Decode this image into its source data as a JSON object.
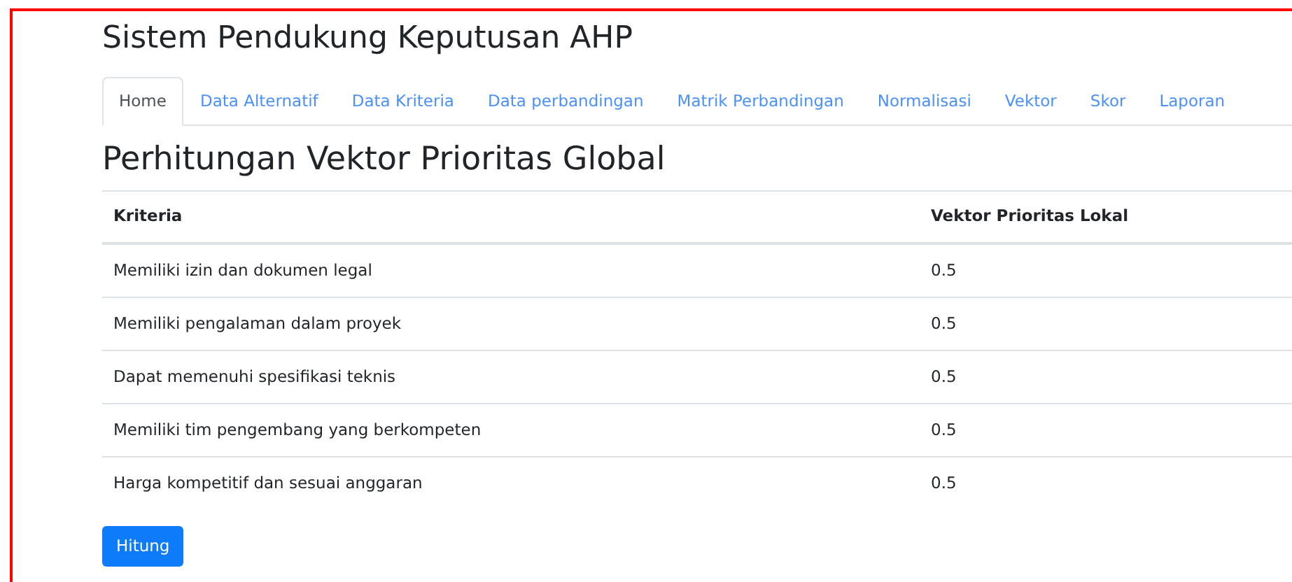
{
  "title": "Sistem Pendukung Keputusan AHP",
  "tabs": [
    {
      "label": "Home",
      "selected": true
    },
    {
      "label": "Data Alternatif",
      "selected": false
    },
    {
      "label": "Data Kriteria",
      "selected": false
    },
    {
      "label": "Data perbandingan",
      "selected": false
    },
    {
      "label": "Matrik Perbandingan",
      "selected": false
    },
    {
      "label": "Normalisasi",
      "selected": false
    },
    {
      "label": "Vektor",
      "selected": false
    },
    {
      "label": "Skor",
      "selected": false
    },
    {
      "label": "Laporan",
      "selected": false
    }
  ],
  "heading": "Perhitungan Vektor Prioritas Global",
  "table": {
    "columns": [
      "Kriteria",
      "Vektor Prioritas Lokal"
    ],
    "rows": [
      [
        "Memiliki izin dan dokumen legal",
        "0.5"
      ],
      [
        "Memiliki pengalaman dalam proyek",
        "0.5"
      ],
      [
        "Dapat memenuhi spesifikasi teknis",
        "0.5"
      ],
      [
        "Memiliki tim pengembang yang berkompeten",
        "0.5"
      ],
      [
        "Harga kompetitif dan sesuai anggaran",
        "0.5"
      ]
    ]
  },
  "button": "Hitung"
}
